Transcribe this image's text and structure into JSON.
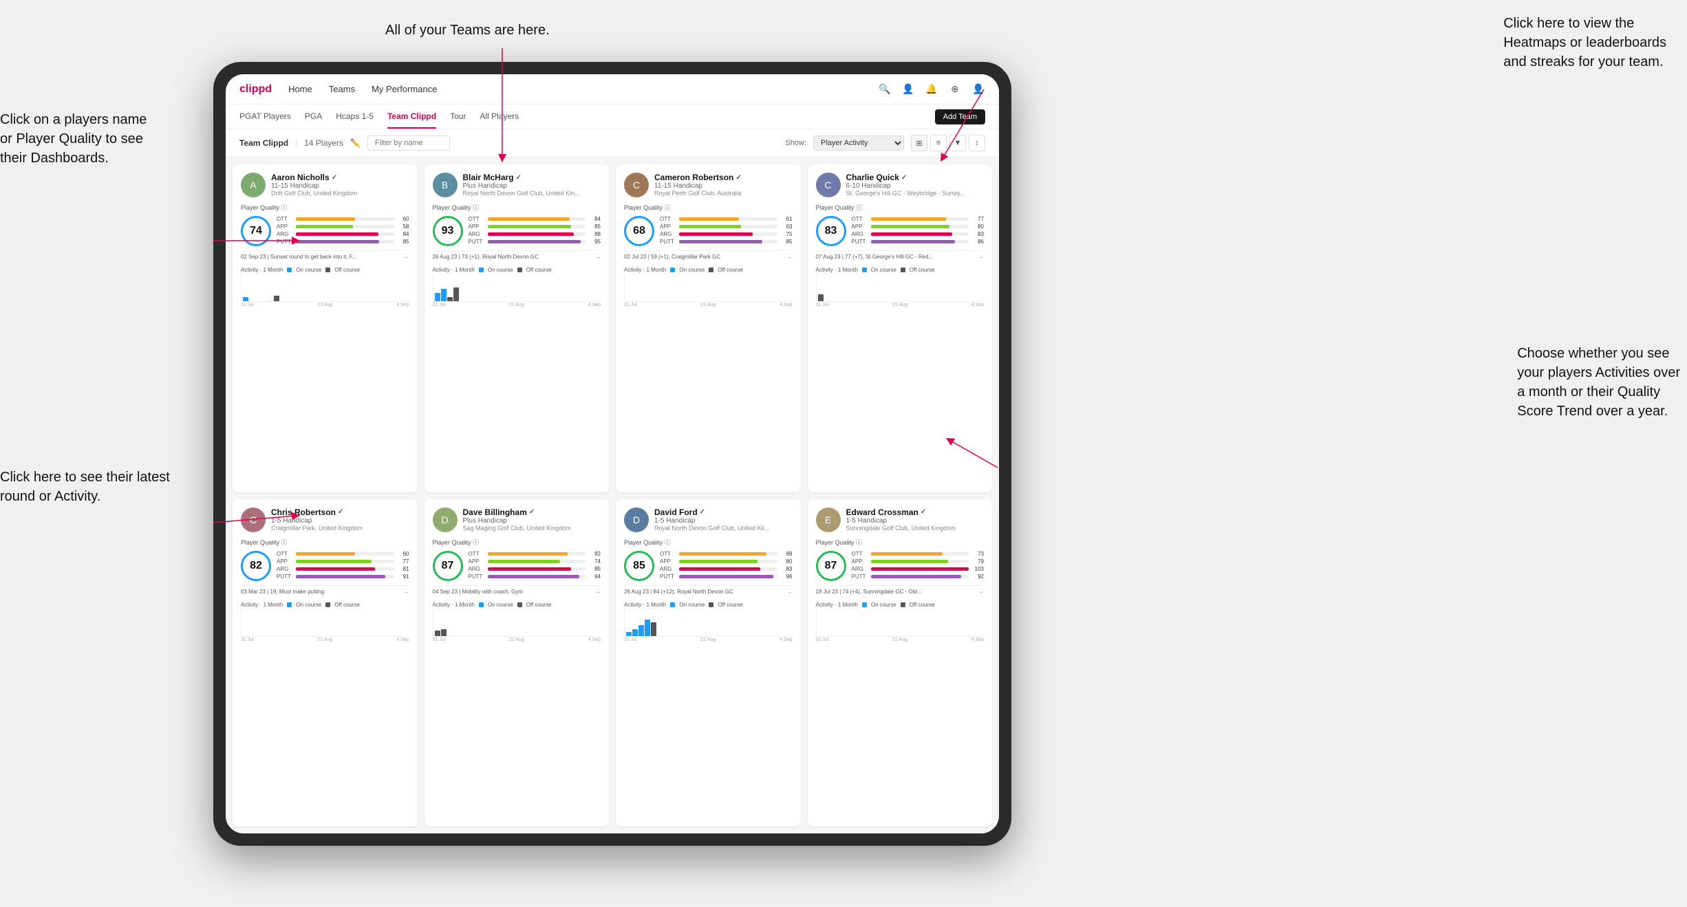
{
  "annotations": {
    "top_center": "All of your Teams are here.",
    "top_right": "Click here to view the Heatmaps or leaderboards and streaks for your team.",
    "left_top": "Click on a players name or Player Quality to see their Dashboards.",
    "left_bottom": "Click here to see their latest round or Activity.",
    "right_bottom": "Choose whether you see your players Activities over a month or their Quality Score Trend over a year."
  },
  "navbar": {
    "logo": "clippd",
    "items": [
      "Home",
      "Teams",
      "My Performance"
    ],
    "icons": [
      "🔍",
      "👤",
      "🔔",
      "⊕",
      "👤"
    ]
  },
  "sub_tabs": {
    "items": [
      "PGAT Players",
      "PGA",
      "Hcaps 1-5",
      "Team Clippd",
      "Tour",
      "All Players"
    ],
    "active": "Team Clippd",
    "add_button": "Add Team"
  },
  "toolbar": {
    "team_label": "Team Clippd",
    "separator": "|",
    "count": "14 Players",
    "filter_placeholder": "Filter by name",
    "show_label": "Show:",
    "show_value": "Player Activity",
    "view_icons": [
      "grid2",
      "grid3",
      "filter",
      "sort"
    ]
  },
  "players": [
    {
      "name": "Aaron Nicholls",
      "handicap": "11-15 Handicap",
      "club": "Drift Golf Club, United Kingdom",
      "quality": 74,
      "quality_color": "blue",
      "stats": [
        {
          "label": "OTT",
          "val": 60,
          "color": "#f5a623"
        },
        {
          "label": "APP",
          "val": 58,
          "color": "#7ed321"
        },
        {
          "label": "ARG",
          "val": 84,
          "color": "#e0004d"
        },
        {
          "label": "PUTT",
          "val": 85,
          "color": "#9b59b6"
        }
      ],
      "latest": "02 Sep 23 | Sunset round to get back into it, F...",
      "activity_label": "Activity · 1 Month",
      "on_course": true,
      "off_course": true,
      "chart_dates": [
        "31 Jul",
        "21 Aug",
        "4 Sep"
      ],
      "bars": [
        {
          "h": 6,
          "color": "#1a9dff"
        },
        {
          "h": 0,
          "color": "#1a9dff"
        },
        {
          "h": 0,
          "color": "#1a9dff"
        },
        {
          "h": 0,
          "color": "#1a9dff"
        },
        {
          "h": 0,
          "color": "#1a9dff"
        },
        {
          "h": 8,
          "color": "#555"
        },
        {
          "h": 0,
          "color": "#555"
        }
      ]
    },
    {
      "name": "Blair McHarg",
      "handicap": "Plus Handicap",
      "club": "Royal North Devon Golf Club, United Kin...",
      "quality": 93,
      "quality_color": "green",
      "stats": [
        {
          "label": "OTT",
          "val": 84,
          "color": "#f5a623"
        },
        {
          "label": "APP",
          "val": 85,
          "color": "#7ed321"
        },
        {
          "label": "ARG",
          "val": 88,
          "color": "#e0004d"
        },
        {
          "label": "PUTT",
          "val": 95,
          "color": "#9b59b6"
        }
      ],
      "latest": "26 Aug 23 | 73 (+1), Royal North Devon GC",
      "activity_label": "Activity · 1 Month",
      "on_course": true,
      "off_course": true,
      "chart_dates": [
        "31 Jul",
        "21 Aug",
        "4 Sep"
      ],
      "bars": [
        {
          "h": 12,
          "color": "#1a9dff"
        },
        {
          "h": 18,
          "color": "#1a9dff"
        },
        {
          "h": 6,
          "color": "#555"
        },
        {
          "h": 20,
          "color": "#555"
        },
        {
          "h": 0,
          "color": "#555"
        }
      ]
    },
    {
      "name": "Cameron Robertson",
      "handicap": "11-15 Handicap",
      "club": "Royal Perth Golf Club, Australia",
      "quality": 68,
      "quality_color": "blue",
      "stats": [
        {
          "label": "OTT",
          "val": 61,
          "color": "#f5a623"
        },
        {
          "label": "APP",
          "val": 63,
          "color": "#7ed321"
        },
        {
          "label": "ARG",
          "val": 75,
          "color": "#e0004d"
        },
        {
          "label": "PUTT",
          "val": 85,
          "color": "#9b59b6"
        }
      ],
      "latest": "02 Jul 23 | 59 (+1), Craigmillar Park GC",
      "activity_label": "Activity · 1 Month",
      "on_course": true,
      "off_course": true,
      "chart_dates": [
        "31 Jul",
        "21 Aug",
        "4 Sep"
      ],
      "bars": [
        {
          "h": 0,
          "color": "#1a9dff"
        },
        {
          "h": 0,
          "color": "#1a9dff"
        },
        {
          "h": 0,
          "color": "#555"
        }
      ]
    },
    {
      "name": "Charlie Quick",
      "handicap": "6-10 Handicap",
      "club": "St. George's Hill GC - Weybridge - Surrey...",
      "quality": 83,
      "quality_color": "blue",
      "stats": [
        {
          "label": "OTT",
          "val": 77,
          "color": "#f5a623"
        },
        {
          "label": "APP",
          "val": 80,
          "color": "#7ed321"
        },
        {
          "label": "ARG",
          "val": 83,
          "color": "#e0004d"
        },
        {
          "label": "PUTT",
          "val": 86,
          "color": "#9b59b6"
        }
      ],
      "latest": "07 Aug 23 | 77 (+7), St George's Hill GC - Red...",
      "activity_label": "Activity · 1 Month",
      "on_course": true,
      "off_course": true,
      "chart_dates": [
        "31 Jul",
        "21 Aug",
        "4 Sep"
      ],
      "bars": [
        {
          "h": 10,
          "color": "#555"
        },
        {
          "h": 0,
          "color": "#555"
        }
      ]
    },
    {
      "name": "Chris Robertson",
      "handicap": "1-5 Handicap",
      "club": "Craigmillar Park, United Kingdom",
      "quality": 82,
      "quality_color": "blue",
      "stats": [
        {
          "label": "OTT",
          "val": 60,
          "color": "#f5a623"
        },
        {
          "label": "APP",
          "val": 77,
          "color": "#7ed321"
        },
        {
          "label": "ARG",
          "val": 81,
          "color": "#e0004d"
        },
        {
          "label": "PUTT",
          "val": 91,
          "color": "#9b59b6"
        }
      ],
      "latest": "03 Mar 23 | 19, Must make putting",
      "activity_label": "Activity · 1 Month",
      "on_course": true,
      "off_course": true,
      "chart_dates": [
        "31 Jul",
        "21 Aug",
        "4 Sep"
      ],
      "bars": []
    },
    {
      "name": "Dave Billingham",
      "handicap": "Plus Handicap",
      "club": "Sag Maging Golf Club, United Kingdom",
      "quality": 87,
      "quality_color": "green",
      "stats": [
        {
          "label": "OTT",
          "val": 82,
          "color": "#f5a623"
        },
        {
          "label": "APP",
          "val": 74,
          "color": "#7ed321"
        },
        {
          "label": "ARG",
          "val": 85,
          "color": "#e0004d"
        },
        {
          "label": "PUTT",
          "val": 94,
          "color": "#9b59b6"
        }
      ],
      "latest": "04 Sep 23 | Mobility with coach, Gym",
      "activity_label": "Activity · 1 Month",
      "on_course": true,
      "off_course": true,
      "chart_dates": [
        "31 Jul",
        "21 Aug",
        "4 Sep"
      ],
      "bars": [
        {
          "h": 8,
          "color": "#555"
        },
        {
          "h": 10,
          "color": "#555"
        }
      ]
    },
    {
      "name": "David Ford",
      "handicap": "1-5 Handicap",
      "club": "Royal North Devon Golf Club, United Kil...",
      "quality": 85,
      "quality_color": "blue",
      "stats": [
        {
          "label": "OTT",
          "val": 89,
          "color": "#f5a623"
        },
        {
          "label": "APP",
          "val": 80,
          "color": "#7ed321"
        },
        {
          "label": "ARG",
          "val": 83,
          "color": "#e0004d"
        },
        {
          "label": "PUTT",
          "val": 96,
          "color": "#9b59b6"
        }
      ],
      "latest": "26 Aug 23 | 84 (+12), Royal North Devon GC",
      "activity_label": "Activity · 1 Month",
      "on_course": true,
      "off_course": true,
      "chart_dates": [
        "31 Jul",
        "21 Aug",
        "4 Sep"
      ],
      "bars": [
        {
          "h": 6,
          "color": "#1a9dff"
        },
        {
          "h": 10,
          "color": "#1a9dff"
        },
        {
          "h": 16,
          "color": "#1a9dff"
        },
        {
          "h": 24,
          "color": "#1a9dff"
        },
        {
          "h": 20,
          "color": "#555"
        }
      ]
    },
    {
      "name": "Edward Crossman",
      "handicap": "1-5 Handicap",
      "club": "Sunningdale Golf Club, United Kingdom",
      "quality": 87,
      "quality_color": "green",
      "stats": [
        {
          "label": "OTT",
          "val": 73,
          "color": "#f5a623"
        },
        {
          "label": "APP",
          "val": 79,
          "color": "#7ed321"
        },
        {
          "label": "ARG",
          "val": 103,
          "color": "#e0004d"
        },
        {
          "label": "PUTT",
          "val": 92,
          "color": "#9b59b6"
        }
      ],
      "latest": "18 Jul 23 | 74 (+4), Sunningdale GC - Old...",
      "activity_label": "Activity · 1 Month",
      "on_course": true,
      "off_course": true,
      "chart_dates": [
        "31 Jul",
        "21 Aug",
        "4 Sep"
      ],
      "bars": []
    }
  ]
}
